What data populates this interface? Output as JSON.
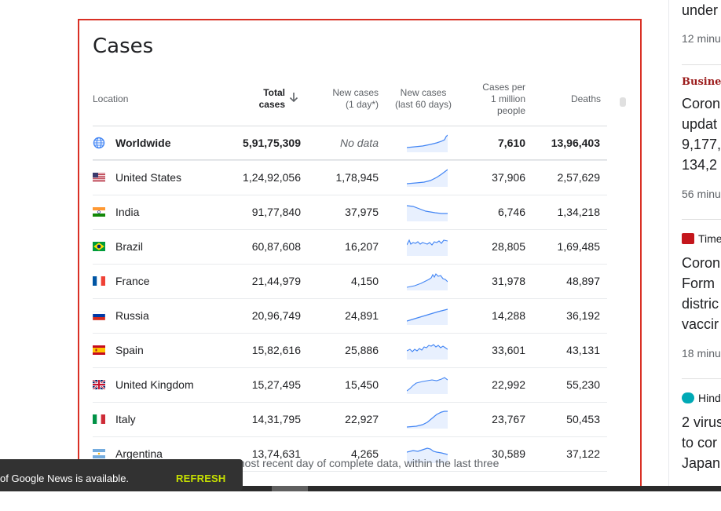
{
  "card": {
    "title": "Cases",
    "headers": {
      "location": "Location",
      "total_line1": "Total",
      "total_line2": "cases",
      "new1_line1": "New cases",
      "new1_line2": "(1 day*)",
      "new60_line1": "New cases",
      "new60_line2": "(last 60 days)",
      "permil_line1": "Cases per",
      "permil_line2": "1 million",
      "permil_line3": "people",
      "deaths": "Deaths"
    },
    "sort_icon": "arrow-down-icon",
    "rows": [
      {
        "location": "Worldwide",
        "total": "5,91,75,309",
        "new1": "No data",
        "permil": "7,610",
        "deaths": "13,96,403",
        "icon": "globe-icon"
      },
      {
        "location": "United States",
        "total": "1,24,92,056",
        "new1": "1,78,945",
        "permil": "37,906",
        "deaths": "2,57,629",
        "icon": "flag-united-states-icon"
      },
      {
        "location": "India",
        "total": "91,77,840",
        "new1": "37,975",
        "permil": "6,746",
        "deaths": "1,34,218",
        "icon": "flag-india-icon"
      },
      {
        "location": "Brazil",
        "total": "60,87,608",
        "new1": "16,207",
        "permil": "28,805",
        "deaths": "1,69,485",
        "icon": "flag-brazil-icon"
      },
      {
        "location": "France",
        "total": "21,44,979",
        "new1": "4,150",
        "permil": "31,978",
        "deaths": "48,897",
        "icon": "flag-france-icon"
      },
      {
        "location": "Russia",
        "total": "20,96,749",
        "new1": "24,891",
        "permil": "14,288",
        "deaths": "36,192",
        "icon": "flag-russia-icon"
      },
      {
        "location": "Spain",
        "total": "15,82,616",
        "new1": "25,886",
        "permil": "33,601",
        "deaths": "43,131",
        "icon": "flag-spain-icon"
      },
      {
        "location": "United Kingdom",
        "total": "15,27,495",
        "new1": "15,450",
        "permil": "22,992",
        "deaths": "55,230",
        "icon": "flag-united-kingdom-icon"
      },
      {
        "location": "Italy",
        "total": "14,31,795",
        "new1": "22,927",
        "permil": "23,767",
        "deaths": "50,453",
        "icon": "flag-italy-icon"
      },
      {
        "location": "Argentina",
        "total": "13,74,631",
        "new1": "4,265",
        "permil": "30,589",
        "deaths": "37,122",
        "icon": "flag-argentina-icon"
      }
    ],
    "footnote": "eported for the most recent day of complete data, within the last three"
  },
  "toast": {
    "message": "of Google News is available.",
    "action": "REFRESH"
  },
  "right_column": {
    "item1_headline": "under",
    "item1_time": "12 minu",
    "item2_source": "Business",
    "item2_headline_1": "Coron",
    "item2_headline_2": "updat",
    "item2_headline_3": "9,177,",
    "item2_headline_4": "134,2",
    "item2_time": "56 minu",
    "item3_source": "Time",
    "item3_headline_1": "Coron",
    "item3_headline_2": "Form",
    "item3_headline_3": "distric",
    "item3_headline_4": "vaccir",
    "item3_time": "18 minu",
    "item4_source": "Hind",
    "item4_headline_1": "2 virus",
    "item4_headline_2": "to cor",
    "item4_headline_3": "Japan"
  },
  "colors": {
    "accent_red": "#d93025",
    "spark_line": "#4285f4",
    "spark_fill": "#e8f0fe",
    "toast_bg": "#323232",
    "refresh": "#c6e000"
  }
}
